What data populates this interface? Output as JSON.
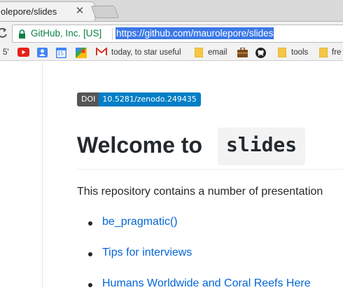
{
  "browser": {
    "tab": {
      "title": "olepore/slides",
      "close_glyph": "✕"
    },
    "omnibox": {
      "secure_label": "GitHub, Inc. [US]",
      "url": "https://github.com/maurolepore/slides"
    },
    "bookmarks": [
      {
        "label": "5'",
        "icon": "none"
      },
      {
        "label": "",
        "icon": "youtube-icon"
      },
      {
        "label": "",
        "icon": "contacts-icon"
      },
      {
        "label": "",
        "icon": "calendar-icon",
        "badge": "15"
      },
      {
        "label": "",
        "icon": "maps-icon"
      },
      {
        "label": "today, to star useful",
        "icon": "gmail-icon"
      },
      {
        "label": "email",
        "icon": "folder-icon"
      },
      {
        "label": "",
        "icon": "briefcase-icon"
      },
      {
        "label": "",
        "icon": "github-icon"
      },
      {
        "label": "tools",
        "icon": "folder-icon"
      },
      {
        "label": "fre",
        "icon": "folder-icon"
      }
    ]
  },
  "readme": {
    "doi_badge": {
      "left": "DOI",
      "right": "10.5281/zenodo.249435"
    },
    "heading": {
      "text": "Welcome to",
      "code": "slides"
    },
    "intro": "This repository contains a number of presentation",
    "links": [
      "be_pragmatic()",
      "Tips for interviews",
      "Humans Worldwide and Coral Reefs Here"
    ]
  },
  "colors": {
    "link": "#0366d6",
    "secure": "#0b8043",
    "url_selection": "#3b78e7",
    "doi_left": "#555555",
    "doi_right": "#007ec6"
  }
}
